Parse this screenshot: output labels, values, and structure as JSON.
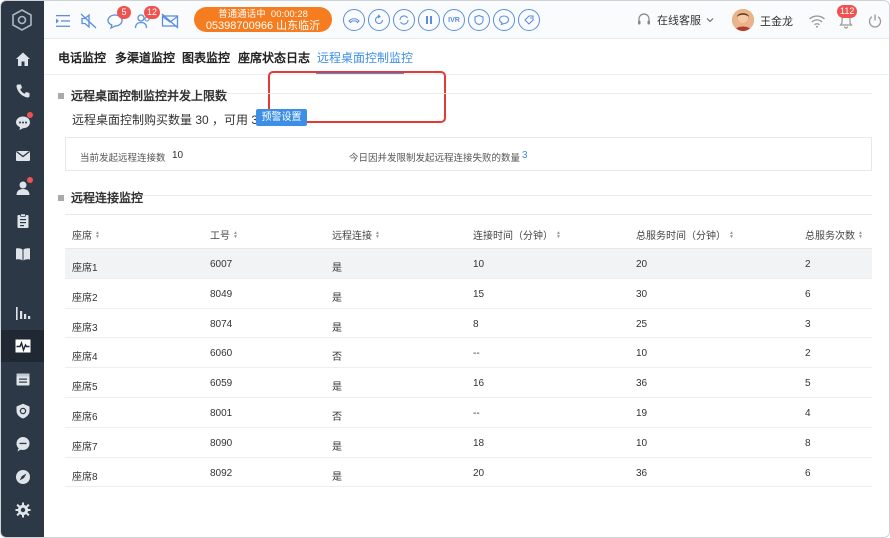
{
  "topbar": {
    "chat_badge": "5",
    "contacts_badge": "12",
    "call": {
      "status": "普通通话中",
      "timer": "00:00:28",
      "number": "05398700966",
      "location": "山东临沂"
    },
    "ivr_label": "IVR",
    "service_label": "在线客服",
    "username": "王金龙",
    "notify_badge": "112"
  },
  "tabs": [
    "电话监控",
    "多渠道监控",
    "图表监控",
    "座席状态日志",
    "远程桌面控制监控"
  ],
  "section1": {
    "title": "远程桌面控制监控并发上限数",
    "quota_text": "远程桌面控制购买数量 30 ，可用 30",
    "warn_button": "预警设置",
    "current_label": "当前发起远程连接数",
    "current_value": "10",
    "failed_label": "今日因并发限制发起远程连接失败的数量",
    "failed_value": "3"
  },
  "section2": {
    "title": "远程连接监控",
    "columns": [
      "座席",
      "工号",
      "远程连接",
      "连接时间（分钟）",
      "总服务时间（分钟）",
      "总服务次数"
    ],
    "rows": [
      [
        "座席1",
        "6007",
        "是",
        "10",
        "20",
        "2"
      ],
      [
        "座席2",
        "8049",
        "是",
        "15",
        "30",
        "6"
      ],
      [
        "座席3",
        "8074",
        "是",
        "8",
        "25",
        "3"
      ],
      [
        "座席4",
        "6060",
        "否",
        "--",
        "10",
        "2"
      ],
      [
        "座席5",
        "6059",
        "是",
        "16",
        "36",
        "5"
      ],
      [
        "座席6",
        "8001",
        "否",
        "--",
        "19",
        "4"
      ],
      [
        "座席7",
        "8090",
        "是",
        "18",
        "10",
        "8"
      ],
      [
        "座席8",
        "8092",
        "是",
        "20",
        "36",
        "6"
      ]
    ]
  },
  "colors": {
    "accent": "#3d8fe6",
    "sidebar": "#2c3846",
    "call_pill": "#f57c1f",
    "highlight": "#e53935",
    "badge": "#ef5350"
  }
}
